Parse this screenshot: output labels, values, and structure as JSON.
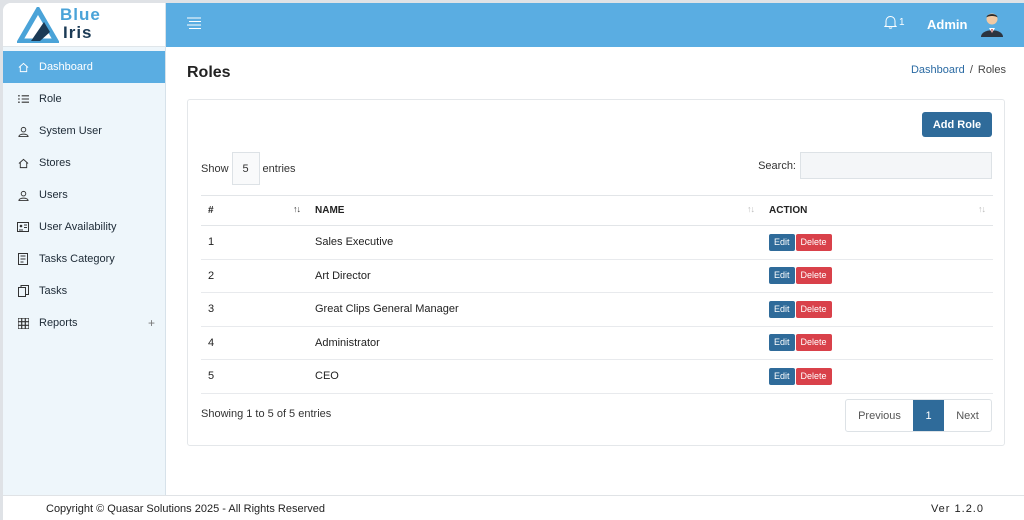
{
  "brand": {
    "line1": "Blue",
    "line2": "Iris"
  },
  "sidebar": {
    "items": [
      {
        "label": "Dashboard",
        "icon": "home-icon"
      },
      {
        "label": "Role",
        "icon": "list-icon"
      },
      {
        "label": "System User",
        "icon": "user-icon"
      },
      {
        "label": "Stores",
        "icon": "home-icon"
      },
      {
        "label": "Users",
        "icon": "user-icon"
      },
      {
        "label": "User Availability",
        "icon": "id-card-icon"
      },
      {
        "label": "Tasks Category",
        "icon": "document-icon"
      },
      {
        "label": "Tasks",
        "icon": "copy-icon"
      },
      {
        "label": "Reports",
        "icon": "grid-icon",
        "expand": "+"
      }
    ],
    "active_index": 0
  },
  "topbar": {
    "notification_count": "1",
    "user_name": "Admin"
  },
  "page": {
    "title": "Roles",
    "breadcrumb": {
      "home": "Dashboard",
      "separator": "/",
      "current": "Roles"
    }
  },
  "toolbar": {
    "add_label": "Add Role",
    "show_label": "Show",
    "entries_value": "5",
    "entries_label": "entries",
    "search_label": "Search:"
  },
  "table": {
    "columns": [
      "#",
      "NAME",
      "ACTION"
    ],
    "rows": [
      {
        "id": "1",
        "name": "Sales Executive"
      },
      {
        "id": "2",
        "name": "Art Director"
      },
      {
        "id": "3",
        "name": "Great Clips General Manager"
      },
      {
        "id": "4",
        "name": "Administrator"
      },
      {
        "id": "5",
        "name": "CEO"
      }
    ],
    "edit_label": "Edit",
    "delete_label": "Delete"
  },
  "pagination": {
    "info": "Showing 1 to 5 of 5 entries",
    "previous": "Previous",
    "current": "1",
    "next": "Next"
  },
  "footer": {
    "copyright": "Copyright © Quasar Solutions 2025 - All Rights Reserved",
    "version": "Ver 1.2.0"
  },
  "colors": {
    "primary": "#5aade2",
    "button": "#2f6b9a",
    "danger": "#d9414a"
  }
}
